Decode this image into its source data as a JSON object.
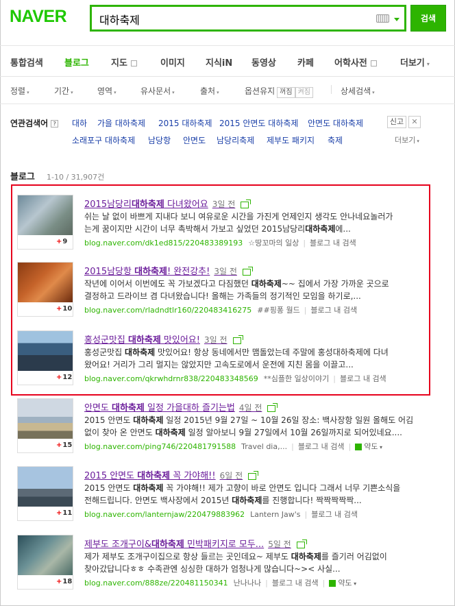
{
  "header": {
    "logo": "NAVER",
    "query": "대하축제",
    "search_button": "검색"
  },
  "tabs": [
    {
      "label": "통합검색",
      "active": false
    },
    {
      "label": "블로그",
      "active": true
    },
    {
      "label": "지도",
      "active": false
    },
    {
      "label": "이미지",
      "active": false
    },
    {
      "label": "지식iN",
      "active": false
    },
    {
      "label": "동영상",
      "active": false
    },
    {
      "label": "카페",
      "active": false
    },
    {
      "label": "어학사전",
      "active": false
    },
    {
      "label": "더보기",
      "active": false
    }
  ],
  "options": {
    "sort": "정렬",
    "period": "기간",
    "area": "영역",
    "similar": "유사문서",
    "source": "출처",
    "keep_option": "옵션유지",
    "keep_off": "꺼짐",
    "keep_on": "켜짐",
    "detail": "상세검색"
  },
  "related": {
    "label": "연관검색어",
    "terms": [
      "대하",
      "가을 대하축제",
      "2015 대하축제",
      "2015 안면도 대하축제",
      "안면도 대하축제",
      "소래포구 대하축제",
      "남당항",
      "안면도",
      "남당리축제",
      "제부도 패키지",
      "축제"
    ],
    "report": "신고",
    "close": "✕",
    "more": "더보기"
  },
  "section": {
    "title": "블로그",
    "count": "1-10 / 31,907건"
  },
  "posts": [
    {
      "title_pre": "2015남당리",
      "title_kw": "대하축제",
      "title_post": " 다녀왔어요",
      "date": "3일 전",
      "line1_pre": "쉬는 날 없이 바쁘게 지내다 보니 여유로운 시간을 가진게 언제인지 생각도 안나네요놀러가",
      "line2_pre": "는게 꿈이지만 시간이 너무 촉박해서 가보고 싶었던 2015남당리",
      "line2_kw": "대하축제",
      "line2_post": "에...",
      "url": "blog.naver.com/dk1ed815/220483389193",
      "author": "☆땅꼬마의 일상",
      "in_blog": "블로그 내 검색",
      "count": "9"
    },
    {
      "title_pre": "2015남당항 ",
      "title_kw": "대하축제",
      "title_post": "! 완전강추!",
      "date": "3일 전",
      "line1_pre": "작년에 이어서 이번에도 꼭 가보겠다고 다짐했던 ",
      "line1_kw": "대하축제",
      "line1_post": "~~ 집에서 가장 가까운 곳으로",
      "line2_pre": "결정하고 드라이브 겸 다녀왔습니다! 올해는 가족들의 정기적인 모임을 하기로,...",
      "url": "blog.naver.com/rladndtlr160/220483416275",
      "author": "##핑퐁 월드",
      "in_blog": "블로그 내 검색",
      "count": "10"
    },
    {
      "title_pre": "홍성군맛집 ",
      "title_kw": "대하축제",
      "title_post": " 맛있어요!",
      "date": "3일 전",
      "line1_pre": "홍성군맛집 ",
      "line1_kw": "대하축제",
      "line1_post": " 맛있어요! 항상 동네에서만 맴돌았는데 주말에 홍성대하축제에 다녀",
      "line2_pre": "왔어요! 거리가 그리 멀지는 않았지만 고속도로에서 운전에 지친 몸을 이끌고...",
      "url": "blog.naver.com/qkrwhdrnr838/220483348569",
      "author": "**심플한 일상이야기",
      "in_blog": "블로그 내 검색",
      "count": "12"
    },
    {
      "title_pre": "안면도 ",
      "title_kw": "대하축제",
      "title_post": " 일정 가을대하 즐기는법",
      "date": "4일 전",
      "line1_pre": "2015 안면도 ",
      "line1_kw": "대하축제",
      "line1_post": " 일정 2015년 9월 27일 ~ 10월 26일 장소: 백사장항 일원 올해도 어김",
      "line2_pre": "없이 찾아 온 안면도 ",
      "line2_kw": "대하축제",
      "line2_post": " 일정 알아보니 9월 27일에서 10월 26일까지로 되어있네요....",
      "url": "blog.naver.com/ping746/220481791588",
      "author": "Travel dia,...",
      "in_blog": "블로그 내 검색",
      "translate": "약도",
      "count": "15"
    },
    {
      "title_pre": "2015 안면도 ",
      "title_kw": "대하축제",
      "title_post": " 꼭 가야해!!",
      "date": "6일 전",
      "line1_pre": "2015 안면도 ",
      "line1_kw": "대하축제",
      "line1_post": " 꼭 가야해!! 제가 고향이 바로 안면도 입니다 그래서 너무 기쁜소식을",
      "line2_pre": "전해드립니다. 안면도 백사장에서 2015년 ",
      "line2_kw": "대하축제",
      "line2_post": "를 진행합니다! 짝짝짝짝짝...",
      "url": "blog.naver.com/lanternjaw/220479883962",
      "author": "Lantern Jaw's",
      "in_blog": "블로그 내 검색",
      "count": "11"
    },
    {
      "title_pre": "제부도 조개구이&",
      "title_kw": "대하축제",
      "title_post": " 민박패키지로 모두...",
      "date": "5일 전",
      "line1_pre": "제가 제부도 조개구이집으로 항상 들르는 곳인데요~ 제부도 ",
      "line1_kw": "대하축제",
      "line1_post": "를 즐기러 어김없이",
      "line2_pre": "찾아갔답니다ㅎㅎ 수족관엔 싱싱한 대하가 엄청나게 많습니다~>< 사실...",
      "url": "blog.naver.com/888ze/220481150341",
      "author": "난나나나",
      "in_blog": "블로그 내 검색",
      "translate": "약도",
      "count": "18"
    }
  ]
}
